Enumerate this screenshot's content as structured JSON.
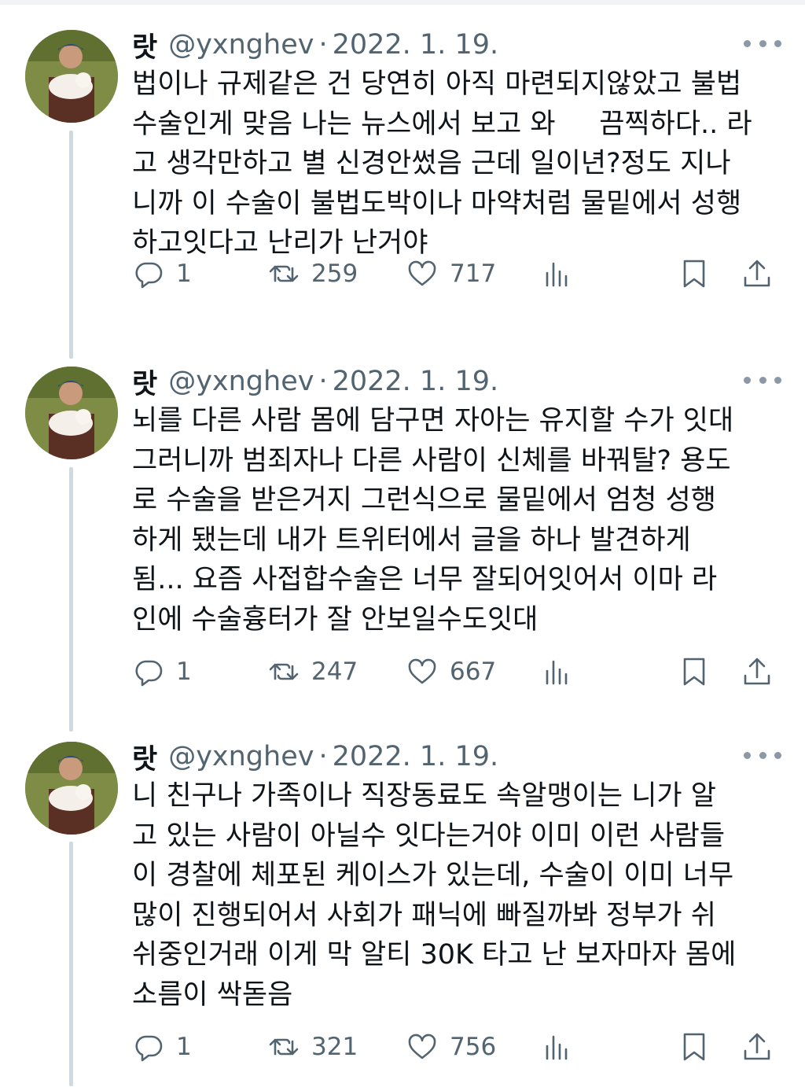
{
  "tweets": [
    {
      "name": "랏",
      "handle": "@yxnghev",
      "separator": "·",
      "date": "2022. 1. 19.",
      "lines": [
        "법이나 규제같은 건 당연히 아직 마련되지않았고 불법",
        "수술인게 맞음 나는 뉴스에서 보고 와     끔찍하다.. 라",
        "고 생각만하고 별 신경안썼음 근데 일이년?정도 지나",
        "니까 이 수술이 불법도박이나 마약처럼 물밑에서 성행",
        "하고잇다고 난리가 난거야"
      ],
      "replies": "1",
      "retweets": "259",
      "likes": "717"
    },
    {
      "name": "랏",
      "handle": "@yxnghev",
      "separator": "·",
      "date": "2022. 1. 19.",
      "lines": [
        "뇌를 다른 사람 몸에 담구면 자아는 유지할 수가 잇대",
        "그러니까 범죄자나 다른 사람이 신체를 바꿔탈? 용도",
        "로 수술을 받은거지 그런식으로 물밑에서 엄청 성행",
        "하게 됐는데 내가 트위터에서 글을 하나 발견하게",
        "됨... 요즘 사접합수술은 너무 잘되어잇어서 이마 라",
        "인에 수술흉터가 잘 안보일수도잇대"
      ],
      "replies": "1",
      "retweets": "247",
      "likes": "667"
    },
    {
      "name": "랏",
      "handle": "@yxnghev",
      "separator": "·",
      "date": "2022. 1. 19.",
      "lines": [
        "니 친구나 가족이나 직장동료도 속알맹이는 니가 알",
        "고 있는 사람이 아닐수 잇다는거야 이미 이런 사람들",
        "이 경찰에 체포된 케이스가 있는데, 수술이 이미 너무",
        "많이 진행되어서 사회가 패닉에 빠질까봐 정부가 쉬",
        "쉬중인거래 이게 막 알티 30K 타고 난 보자마자 몸에",
        "소름이 싹돋음"
      ],
      "replies": "1",
      "retweets": "321",
      "likes": "756"
    }
  ]
}
